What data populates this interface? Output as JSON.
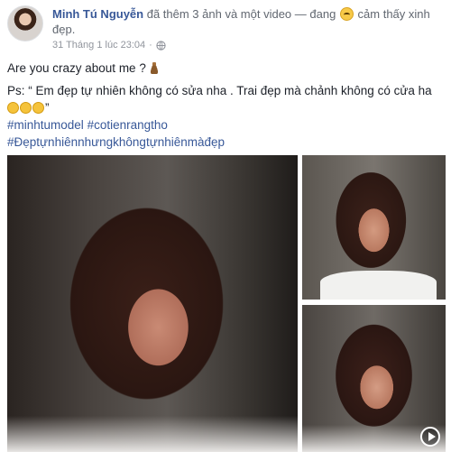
{
  "post": {
    "author": "Minh Tú Nguyễn",
    "action_text": " đã thêm 3 ảnh và một video — đang ",
    "feeling_text": " cảm thấy xinh đẹp.",
    "feeling_icon": "smiling-face-icon",
    "timestamp": "31 Tháng 1 lúc 23:04",
    "separator": "·",
    "privacy_icon": "globe-icon"
  },
  "content": {
    "line1": "Are you crazy about me ?",
    "line1_icon": "poop-icon",
    "line2": "Ps: “ Em đẹp tự nhiên không có sửa nha . Trai đẹp mà chảnh không có cửa ha",
    "line3_suffix": "”",
    "line3_emoji_icon": "rolling-laughing-icon",
    "hashtags_line1": [
      "#minhtumodel",
      "#cotienrangtho"
    ],
    "hashtags_line2": [
      "#Đẹptựnhiênnhưngkhôngtựnhiênmàđẹp"
    ]
  },
  "media": {
    "items": [
      "photo",
      "photo",
      "photo-video"
    ],
    "video_icon": "play-icon"
  },
  "colors": {
    "link": "#385898",
    "meta": "#90949c",
    "text": "#1d2129"
  }
}
